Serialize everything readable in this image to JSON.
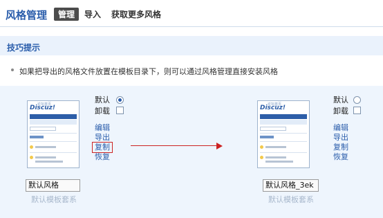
{
  "header": {
    "title": "风格管理",
    "tabs": [
      {
        "label": "管理",
        "active": true
      },
      {
        "label": "导入",
        "active": false
      },
      {
        "label": "获取更多风格",
        "active": false
      }
    ]
  },
  "tips": {
    "title": "技巧提示",
    "items": [
      "如果把导出的风格文件放置在模板目录下，则可以通过风格管理直接安装风格"
    ]
  },
  "demo": {
    "left": {
      "thumbnail_logo": "Discuz!",
      "thumbnail_logo_small": "论坛首页",
      "default_label": "默认",
      "default_checked": true,
      "uninstall_label": "卸载",
      "actions": [
        "编辑",
        "导出",
        "复制",
        "恢复"
      ],
      "highlighted_action": "复制",
      "name_value": "默认风格",
      "template_caption": "默认模板套系"
    },
    "right": {
      "thumbnail_logo": "Discuz!",
      "thumbnail_logo_small": "论坛首页",
      "default_label": "默认",
      "default_checked": false,
      "uninstall_label": "卸载",
      "actions": [
        "编辑",
        "导出",
        "复制",
        "恢复"
      ],
      "name_value": "默认风格_3ek",
      "template_caption": "默认模板套系"
    },
    "arrow_color": "#cc2222"
  },
  "colors": {
    "accent": "#2a5dab",
    "tip_bg": "#eaf2fc",
    "panel_bg": "#eef5fd",
    "tab_active_bg": "#4c4c4c",
    "highlight": "#cc2222"
  }
}
